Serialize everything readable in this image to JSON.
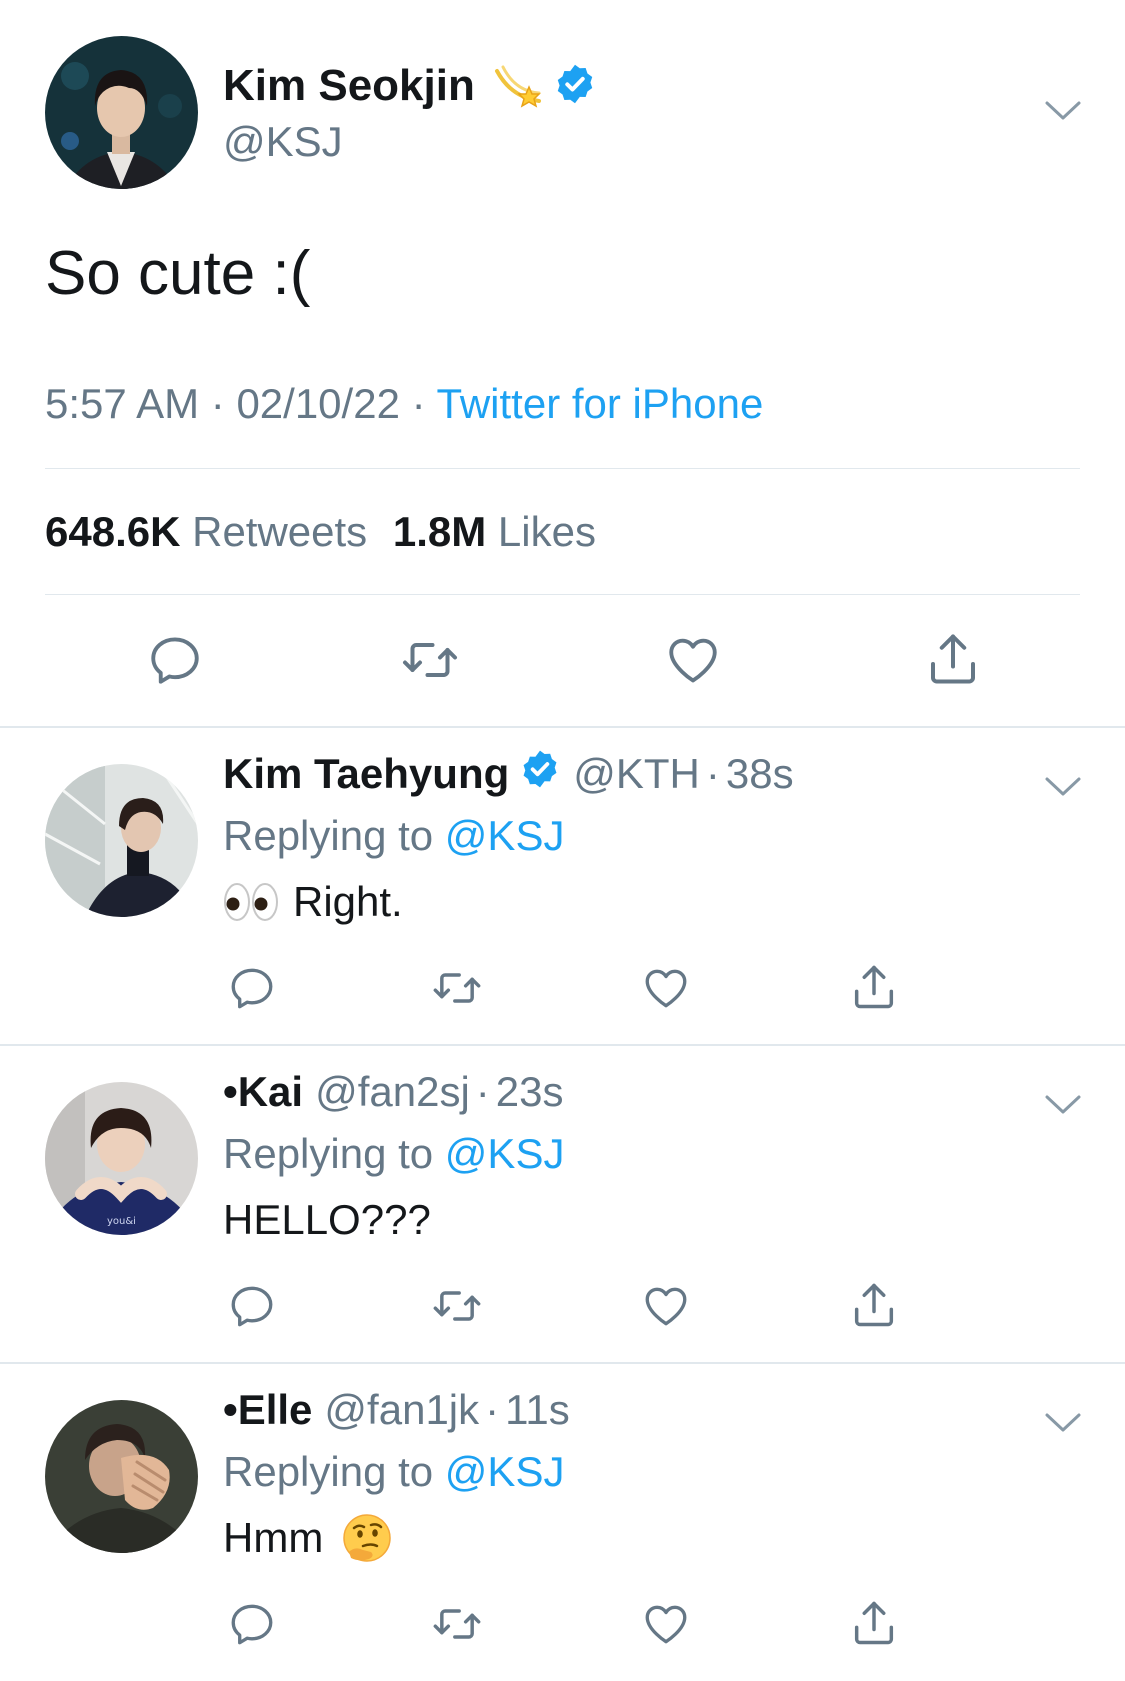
{
  "main_tweet": {
    "name": "Kim Seokjin",
    "name_emoji": "dizzy-star-emoji",
    "verified": true,
    "handle": "@KSJ",
    "text": "So cute :(",
    "time": "5:57 AM",
    "date": "02/10/22",
    "source": "Twitter for iPhone",
    "retweets_count": "648.6K",
    "retweets_label": "Retweets",
    "likes_count": "1.8M",
    "likes_label": "Likes",
    "actions": [
      "reply-icon",
      "retweet-icon",
      "like-icon",
      "share-icon"
    ]
  },
  "replies": [
    {
      "name": "Kim Taehyung",
      "verified": true,
      "handle": "@KTH",
      "age": "38s",
      "replying_prefix": "Replying to",
      "replying_to": "@KSJ",
      "text": "Right.",
      "emoji": "eyes-emoji"
    },
    {
      "name": "•Kai",
      "verified": false,
      "handle": "@fan2sj",
      "age": "23s",
      "replying_prefix": "Replying to",
      "replying_to": "@KSJ",
      "text": "HELLO???"
    },
    {
      "name": "•Elle",
      "verified": false,
      "handle": "@fan1jk",
      "age": "11s",
      "replying_prefix": "Replying to",
      "replying_to": "@KSJ",
      "text": "Hmm",
      "emoji": "thinking-face-emoji"
    }
  ],
  "colors": {
    "accent": "#1da1f2",
    "text": "#14171a",
    "secondary": "#657786",
    "divider": "#e1e8ed"
  }
}
